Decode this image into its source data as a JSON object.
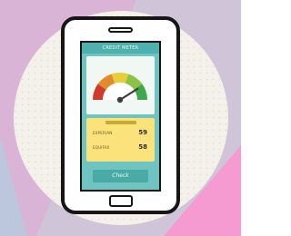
{
  "app": {
    "header_title": "CREDIT METER"
  },
  "gauge": {
    "needle_value": 0.82,
    "segment_colors": [
      "#cf3a2a",
      "#e38a2a",
      "#e8cd38",
      "#8dc245",
      "#3ea94a"
    ]
  },
  "scores": [
    {
      "label": "EXPERIAN",
      "value": "59"
    },
    {
      "label": "EQUIFAX",
      "value": "58"
    }
  ],
  "footer": {
    "label": "Check"
  },
  "colors": {
    "screen": "#6fc4c2",
    "panel": "#fbe27a",
    "background_circle": "#f4f0ea",
    "accent_purple": "#d6b0d8",
    "accent_pink": "#f59bd2"
  }
}
